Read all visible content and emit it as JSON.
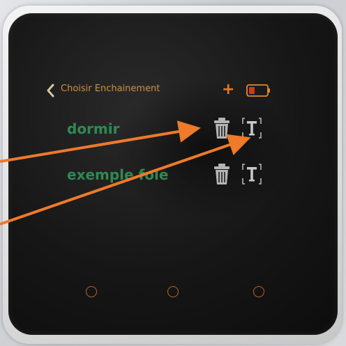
{
  "header": {
    "title": "Choisir Enchainement",
    "back_icon": "chevron-left-icon",
    "add_icon": "plus-icon",
    "battery_icon": "battery-low-icon"
  },
  "list": {
    "items": [
      {
        "label": "dormir",
        "delete_icon": "trash-icon",
        "rename_icon": "text-edit-icon"
      },
      {
        "label": "exemple fole",
        "delete_icon": "trash-icon",
        "rename_icon": "text-edit-icon"
      }
    ]
  },
  "softkeys": [
    {
      "icon": "circle-button-icon"
    },
    {
      "icon": "circle-button-icon"
    },
    {
      "icon": "circle-button-icon"
    }
  ],
  "colors": {
    "title": "#d28f3d",
    "accent": "#e87b22",
    "item_text": "#2e8a52",
    "icon_gray": "#b5b5b5",
    "battery_fill": "#cc3b1e",
    "annotation_arrow": "#ee7a2a"
  }
}
